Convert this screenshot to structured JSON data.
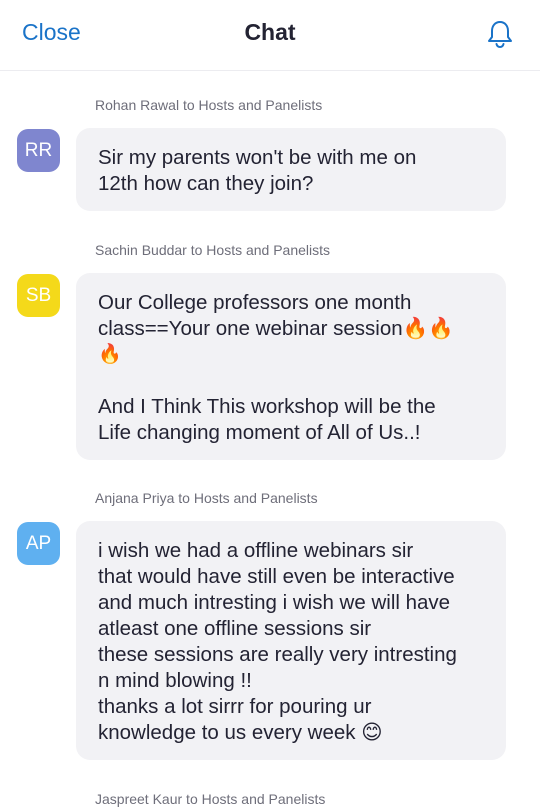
{
  "header": {
    "close_label": "Close",
    "title": "Chat",
    "bell_icon": "bell-icon"
  },
  "colors": {
    "accent": "#1a73c8",
    "bubble_bg": "#f2f2f5",
    "avatar_rr": "#7f86cf",
    "avatar_sb": "#f4d91a",
    "avatar_ap": "#5fb0f0"
  },
  "messages": [
    {
      "sender": "Rohan Rawal to Hosts and Panelists",
      "initials": "RR",
      "lines": [
        "Sir my parents won't be with me on",
        "12th how can they join?"
      ]
    },
    {
      "sender": "Sachin Buddar to Hosts and Panelists",
      "initials": "SB",
      "lines": [
        "Our College professors one month",
        "class==Your one webinar session🔥🔥",
        "🔥",
        "",
        "And I Think This workshop will be the",
        "Life changing moment of All of Us..!"
      ]
    },
    {
      "sender": "Anjana Priya to Hosts and Panelists",
      "initials": "AP",
      "lines": [
        "i wish we had a offline webinars sir",
        "that would have still even be interactive",
        "and much intresting i wish we will have",
        "atleast one offline sessions sir",
        "these sessions are really very intresting",
        "n mind blowing !!",
        "thanks a lot sirrr for pouring ur",
        "knowledge to us every week 😊"
      ]
    },
    {
      "sender": "Jaspreet Kaur to Hosts and Panelists"
    }
  ]
}
